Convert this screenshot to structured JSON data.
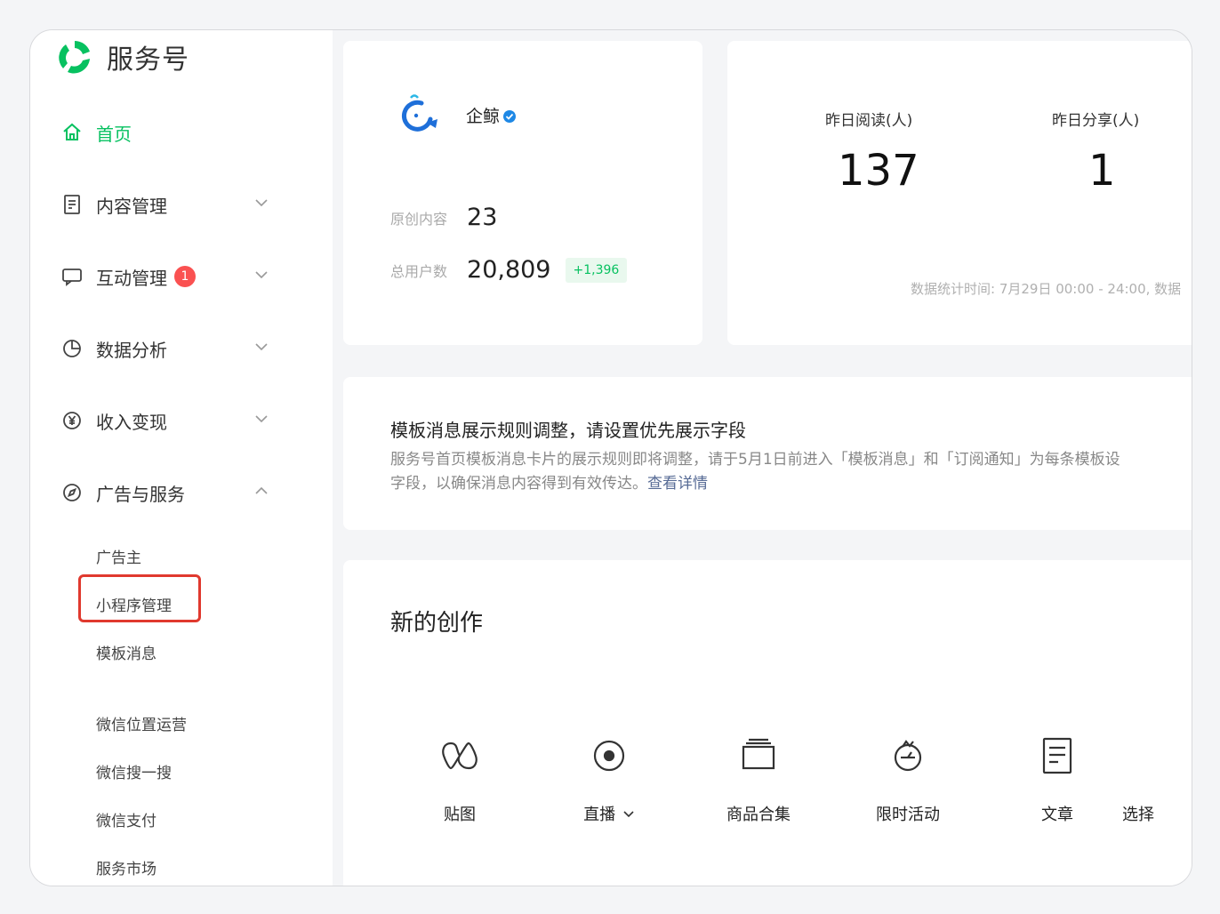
{
  "app": {
    "name": "服务号"
  },
  "sidebar": {
    "items": [
      {
        "label": "首页"
      },
      {
        "label": "内容管理"
      },
      {
        "label": "互动管理",
        "badge": "1"
      },
      {
        "label": "数据分析"
      },
      {
        "label": "收入变现"
      },
      {
        "label": "广告与服务"
      }
    ],
    "sub_items": [
      "广告主",
      "小程序管理",
      "模板消息",
      "微信位置运营",
      "微信搜一搜",
      "微信支付",
      "服务市场"
    ]
  },
  "account": {
    "name": "企鲸",
    "original_label": "原创内容",
    "original_value": "23",
    "users_label": "总用户数",
    "users_value": "20,809",
    "users_delta": "+1,396"
  },
  "stats": {
    "read_label": "昨日阅读(人)",
    "read_value": "137",
    "share_label": "昨日分享(人)",
    "share_value": "1",
    "footnote": "数据统计时间: 7月29日 00:00 - 24:00, 数据"
  },
  "notice": {
    "title": "模板消息展示规则调整，请设置优先展示字段",
    "line1": "服务号首页模板消息卡片的展示规则即将调整，请于5月1日前进入「模板消息」和「订阅通知」为每条模板设",
    "line2": "字段，以确保消息内容得到有效传达。",
    "link": "查看详情"
  },
  "create": {
    "title": "新的创作",
    "tools": [
      {
        "label": "贴图",
        "icon": "sticker-icon"
      },
      {
        "label": "直播",
        "icon": "live-icon"
      },
      {
        "label": "商品合集",
        "icon": "product-collection-icon"
      },
      {
        "label": "限时活动",
        "icon": "timed-activity-icon"
      },
      {
        "label": "文章",
        "icon": "article-icon"
      },
      {
        "label": "选择",
        "icon": ""
      }
    ]
  },
  "colors": {
    "accent": "#07c160",
    "badge": "#fa5151",
    "highlight": "#e0392e",
    "link": "#576b95"
  }
}
